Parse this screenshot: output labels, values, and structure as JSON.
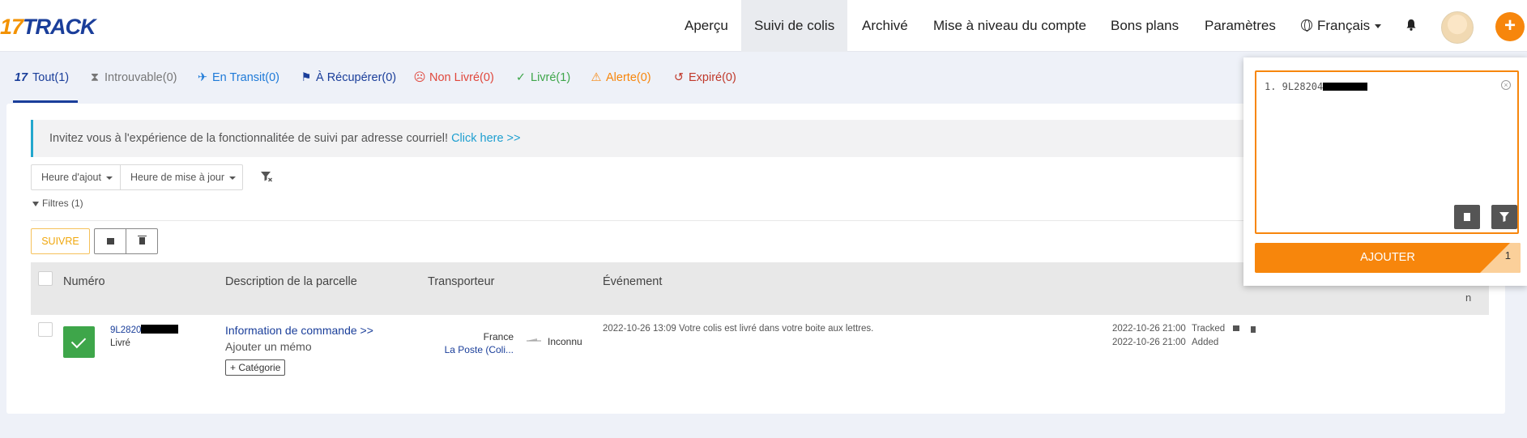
{
  "logo": {
    "num": "17",
    "txt": "TRACK"
  },
  "nav": {
    "items": [
      {
        "label": "Aperçu"
      },
      {
        "label": "Suivi de colis"
      },
      {
        "label": "Archivé"
      },
      {
        "label": "Mise à niveau du compte"
      },
      {
        "label": "Bons plans"
      },
      {
        "label": "Paramètres"
      }
    ],
    "language": "Français",
    "plus": "+"
  },
  "tabs": [
    {
      "label": "Tout(1)",
      "icon": "17-logo-icon",
      "color": "#1a3e9a"
    },
    {
      "label": "Introuvable(0)",
      "icon": "hourglass-icon",
      "color": "#777777"
    },
    {
      "label": "En Transit(0)",
      "icon": "airplane-icon",
      "color": "#1e7ad8"
    },
    {
      "label": "À Récupérer(0)",
      "icon": "flag-icon",
      "color": "#1a3e9a"
    },
    {
      "label": "Non Livré(0)",
      "icon": "sad-face-icon",
      "color": "#e0473c"
    },
    {
      "label": "Livré(1)",
      "icon": "check-icon",
      "color": "#3ea64a"
    },
    {
      "label": "Alerte(0)",
      "icon": "warning-icon",
      "color": "#f7860c"
    },
    {
      "label": "Expiré(0)",
      "icon": "history-icon",
      "color": "#c0392b"
    }
  ],
  "banner": {
    "text": "Invitez vous à l'expérience de la fonctionnalitée de suivi par adresse courriel!",
    "link": "Click here >>"
  },
  "sort": {
    "added": "Heure d'ajout",
    "updated": "Heure de mise à jour"
  },
  "filters": "Filtres (1)",
  "actions": {
    "follow": "SUIVRE"
  },
  "table": {
    "headers": {
      "number": "Numéro",
      "description": "Description de la parcelle",
      "carrier": "Transporteur",
      "event": "Événement",
      "last": "n"
    },
    "rows": [
      {
        "number": "9L2820",
        "status": "Livré",
        "order_info": "Information de commande >>",
        "memo": "Ajouter un mémo",
        "category": "+ Catégorie",
        "origin_country": "France",
        "carrier": "La Poste (Coli...",
        "destination": "Inconnu",
        "event": "2022-10-26 13:09 Votre colis est livré dans votre boite aux lettres.",
        "tracked_time": "2022-10-26 21:00",
        "tracked_label": "Tracked",
        "added_time": "2022-10-26 21:00",
        "added_label": "Added"
      }
    ]
  },
  "panel": {
    "entry": "1. 9L28204",
    "clear": "×",
    "submit": "AJOUTER",
    "count": "1"
  }
}
